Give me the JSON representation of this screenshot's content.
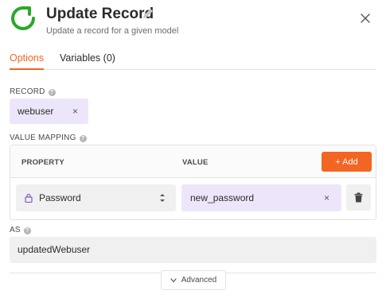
{
  "header": {
    "title": "Update Record",
    "subtitle": "Update a record for a given model",
    "logo_color": "#29a829"
  },
  "tabs": [
    {
      "label": "Options",
      "active": true
    },
    {
      "label": "Variables (0)",
      "active": false
    }
  ],
  "record": {
    "label": "RECORD",
    "value": "webuser",
    "remove_glyph": "×"
  },
  "value_mapping": {
    "label": "VALUE MAPPING",
    "columns": {
      "property": "PROPERTY",
      "value": "VALUE"
    },
    "add_label": "+ Add",
    "rows": [
      {
        "property": "Password",
        "value": "new_password",
        "remove_glyph": "×"
      }
    ]
  },
  "as": {
    "label": "AS",
    "value": "updatedWebuser"
  },
  "advanced": {
    "label": "Advanced"
  },
  "colors": {
    "accent": "#f26522",
    "chip_bg": "#ede6fb",
    "field_bg": "#f0f0f0"
  },
  "icons": [
    "refresh-icon",
    "pencil-icon",
    "close-icon",
    "help-icon",
    "lock-icon",
    "sort-icon",
    "trash-icon",
    "chevron-down-icon"
  ]
}
